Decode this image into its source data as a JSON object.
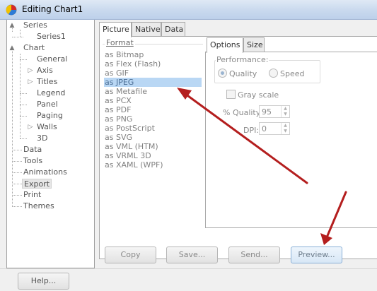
{
  "window": {
    "title": "Editing Chart1"
  },
  "tree": {
    "items": [
      {
        "label": "Series",
        "level": 0,
        "expander": ""
      },
      {
        "label": "Series1",
        "level": 1,
        "expander": ""
      },
      {
        "label": "Chart",
        "level": 0,
        "expander": ""
      },
      {
        "label": "General",
        "level": 1,
        "expander": ""
      },
      {
        "label": "Axis",
        "level": 1,
        "expander": "▷"
      },
      {
        "label": "Titles",
        "level": 1,
        "expander": "▷"
      },
      {
        "label": "Legend",
        "level": 1,
        "expander": ""
      },
      {
        "label": "Panel",
        "level": 1,
        "expander": ""
      },
      {
        "label": "Paging",
        "level": 1,
        "expander": ""
      },
      {
        "label": "Walls",
        "level": 1,
        "expander": "▷"
      },
      {
        "label": "3D",
        "level": 1,
        "expander": ""
      },
      {
        "label": "Data",
        "level": 0,
        "expander": ""
      },
      {
        "label": "Tools",
        "level": 0,
        "expander": ""
      },
      {
        "label": "Animations",
        "level": 0,
        "expander": ""
      },
      {
        "label": "Export",
        "level": 0,
        "expander": "",
        "selected": true
      },
      {
        "label": "Print",
        "level": 0,
        "expander": ""
      },
      {
        "label": "Themes",
        "level": 0,
        "expander": ""
      }
    ]
  },
  "tabs": [
    "Picture",
    "Native",
    "Data"
  ],
  "format": {
    "label": "Format",
    "items": [
      "as Bitmap",
      "as Flex (Flash)",
      "as GIF",
      "as JPEG",
      "as Metafile",
      "as PCX",
      "as PDF",
      "as PNG",
      "as PostScript",
      "as SVG",
      "as VML (HTM)",
      "as VRML 3D",
      "as XAML (WPF)"
    ],
    "selected_index": 3
  },
  "options": {
    "tabs": [
      "Options",
      "Size"
    ],
    "performance_label": "Performance:",
    "quality_label": "Quality",
    "speed_label": "Speed",
    "performance_selected": "Quality",
    "grayscale_label": "Gray scale",
    "grayscale_checked": false,
    "quality_pct_label": "% Quality:",
    "quality_pct_value": "95",
    "dpi_label": "DPI:",
    "dpi_value": "0"
  },
  "buttons": {
    "copy": "Copy",
    "save": "Save...",
    "send": "Send...",
    "preview": "Preview...",
    "help": "Help..."
  },
  "colors": {
    "selection": "#b9d7f4",
    "arrow": "#b41e1e",
    "titlebar": "#c9d9ee"
  }
}
